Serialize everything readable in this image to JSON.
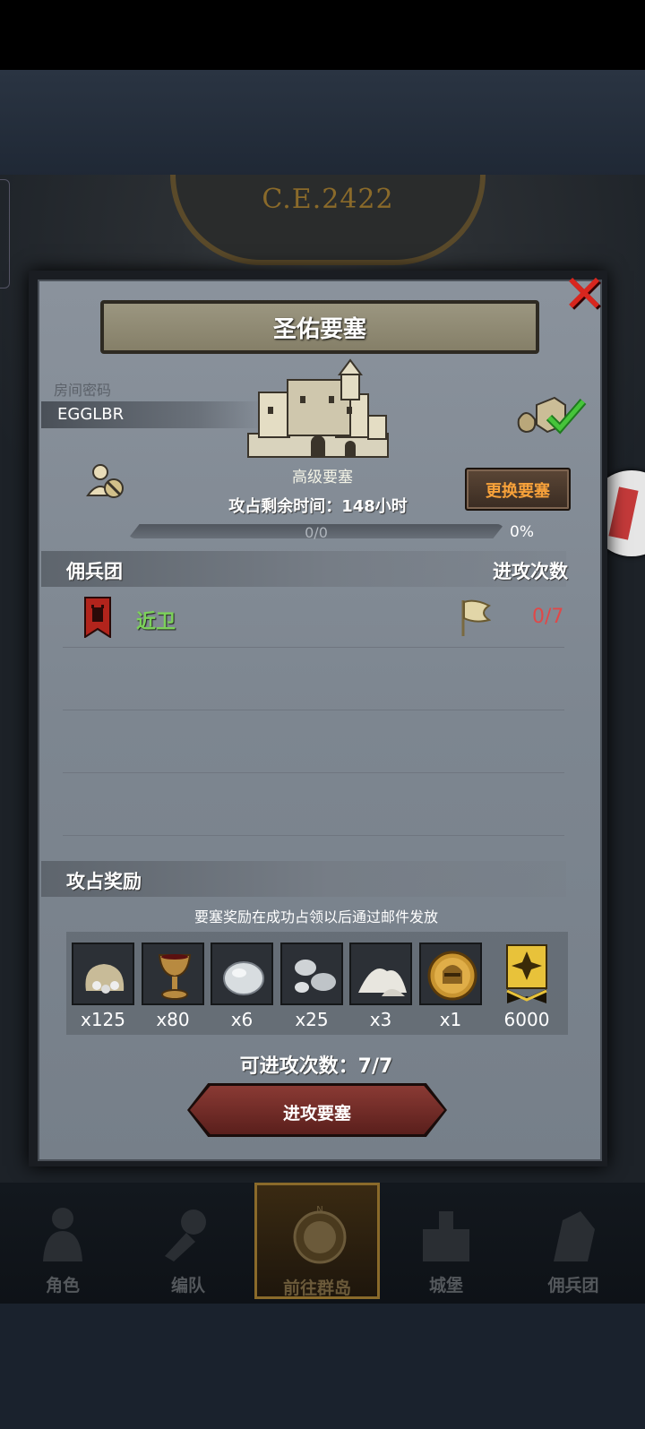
{
  "background": {
    "era_label": "C.E.2422"
  },
  "dialog": {
    "title": "圣佑要塞",
    "room_label": "房间密码",
    "room_code": "EGGLBR",
    "fortress_level": "高级要塞",
    "change_button": "更换要塞",
    "time_remaining": "攻占剩余时间：148小时",
    "progress": {
      "text": "0/0",
      "percent_text": "0%",
      "fraction": 0
    },
    "mercenary_header": "佣兵团",
    "attacks_header": "进攻次数",
    "mercenaries": [
      {
        "name": "近卫",
        "attack_count": "0/7"
      }
    ],
    "rewards_header": "攻占奖励",
    "rewards_note": "要塞奖励在成功占领以后通过邮件发放",
    "rewards": [
      {
        "icon": "silver-sack-icon",
        "qty": "x125"
      },
      {
        "icon": "goblet-icon",
        "qty": "x80"
      },
      {
        "icon": "stone-icon",
        "qty": "x6"
      },
      {
        "icon": "silver-ore-icon",
        "qty": "x25"
      },
      {
        "icon": "salt-pile-icon",
        "qty": "x3"
      },
      {
        "icon": "helmet-coin-icon",
        "qty": "x1"
      },
      {
        "icon": "rank-medal-icon",
        "qty": "6000"
      }
    ],
    "attempts_left": "可进攻次数：7/7",
    "attack_button": "进攻要塞"
  },
  "nav": [
    {
      "label": "角色",
      "icon": "knight-icon"
    },
    {
      "label": "编队",
      "icon": "formation-icon"
    },
    {
      "label": "前往群岛",
      "icon": "compass-icon",
      "active": true
    },
    {
      "label": "城堡",
      "icon": "castle-icon"
    },
    {
      "label": "佣兵团",
      "icon": "mercenary-icon"
    }
  ],
  "colors": {
    "accent_green": "#7cd15a",
    "count_red": "#e04848",
    "button_orange": "#f7a13a"
  }
}
